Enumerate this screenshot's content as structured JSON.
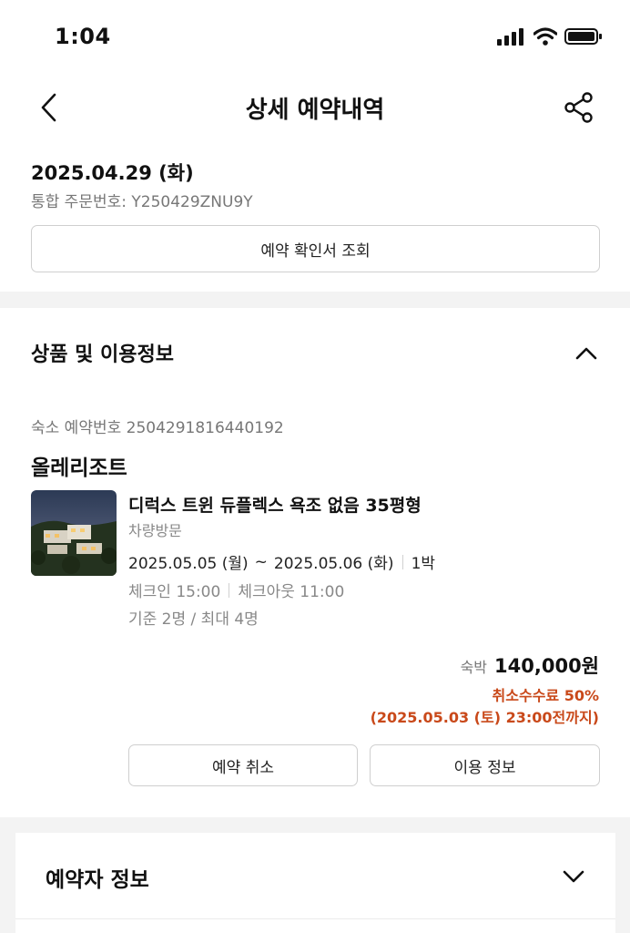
{
  "status_bar": {
    "time": "1:04",
    "icons": [
      "signal-icon",
      "wifi-icon",
      "battery-icon"
    ]
  },
  "nav": {
    "title": "상세 예약내역",
    "back_icon": "chevron-left-icon",
    "share_icon": "share-icon"
  },
  "order": {
    "date": "2025.04.29 (화)",
    "number": "통합 주문번호: Y250429ZNU9Y",
    "confirm_button": "예약 확인서 조회"
  },
  "product_section": {
    "title": "상품 및 이용정보",
    "stay_number": "숙소 예약번호 2504291816440192",
    "property_name": "올레리조트",
    "room_name": "디럭스 트윈 듀플렉스 욕조 없음 35평형",
    "visit_type": "차량방문",
    "check_in_date": "2025.05.05 (월)",
    "date_separator": "~",
    "check_out_date": "2025.05.06 (화)",
    "nights": "1박",
    "check_in_time": "체크인 15:00",
    "check_out_time": "체크아웃 11:00",
    "capacity": "기준 2명 / 최대 4명",
    "price_label": "숙박",
    "price": "140,000원",
    "cancel_fee": "취소수수료 50%",
    "cancel_deadline": "(2025.05.03 (토) 23:00전까지)",
    "cancel_button": "예약 취소",
    "info_button": "이용 정보"
  },
  "booker_section": {
    "title": "예약자 정보"
  },
  "colors": {
    "accent_warning": "#c9491a",
    "border": "#cfcfcf",
    "band": "#f3f3f3"
  }
}
